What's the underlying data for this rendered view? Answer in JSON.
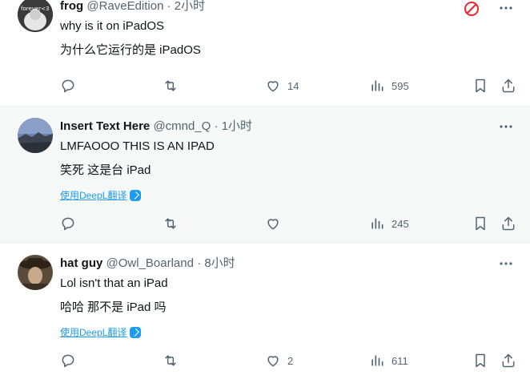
{
  "tweets": [
    {
      "name": "frog",
      "handle": "@RaveEdition",
      "separator": "·",
      "time": "2小时",
      "avatar_text": "forever<3",
      "text": "why is it on iPadOS",
      "translation": "为什么它运行的是 iPadOS",
      "translate_link": "",
      "likes": "14",
      "views": "595"
    },
    {
      "name": "Insert Text Here",
      "handle": "@cmnd_Q",
      "separator": "·",
      "time": "1小时",
      "text": "LMFAOOO THIS IS AN IPAD",
      "translation": "笑死 这是台 iPad",
      "translate_link": "使用DeepL翻译",
      "likes": "",
      "views": "245"
    },
    {
      "name": "hat guy",
      "handle": "@Owl_Boarland",
      "separator": "·",
      "time": "8小时",
      "text": "Lol isn't that an iPad",
      "translation": "哈哈 那不是 iPad 吗",
      "translate_link": "使用DeepL翻译",
      "likes": "2",
      "views": "611"
    }
  ],
  "colors": {
    "text": "#0f1419",
    "muted": "#536471",
    "link": "#1d9bf0",
    "block": "#f4212e"
  }
}
